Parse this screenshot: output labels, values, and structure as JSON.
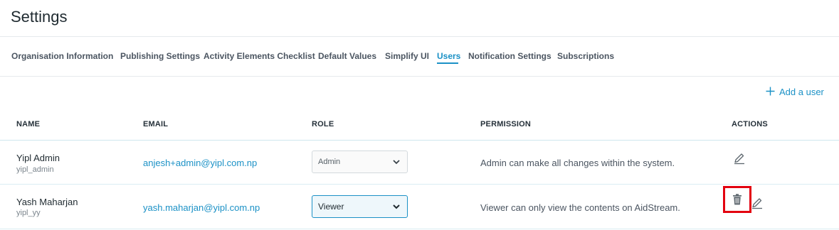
{
  "header": {
    "title": "Settings"
  },
  "tabs": [
    {
      "label": "Organisation Information",
      "active": false
    },
    {
      "label": "Publishing Settings",
      "active": false
    },
    {
      "label": "Activity Elements Checklist",
      "active": false
    },
    {
      "label": "Default Values",
      "active": false
    },
    {
      "label": "Simplify UI",
      "active": false
    },
    {
      "label": "Users",
      "active": true
    },
    {
      "label": "Notification Settings",
      "active": false
    },
    {
      "label": "Subscriptions",
      "active": false
    }
  ],
  "actions": {
    "add_user": "Add a user",
    "add_icon": "plus-icon"
  },
  "table": {
    "columns": {
      "name": "NAME",
      "email": "EMAIL",
      "role": "ROLE",
      "permission": "PERMISSION",
      "actions": "ACTIONS"
    },
    "rows": [
      {
        "name": "Yipl Admin",
        "handle": "yipl_admin",
        "email": "anjesh+admin@yipl.com.np",
        "role": "Admin",
        "permission": "Admin can make all changes within the system.",
        "action_icons": [
          "edit-icon"
        ]
      },
      {
        "name": "Yash Maharjan",
        "handle": "yipl_yy",
        "email": "yash.maharjan@yipl.com.np",
        "role": "Viewer",
        "permission": "Viewer can only view the contents on AidStream.",
        "action_icons": [
          "trash-icon",
          "edit-icon"
        ]
      }
    ]
  },
  "colors": {
    "accent": "#1b91c6",
    "highlight": "#e3000f",
    "text": "#2a2f33"
  }
}
